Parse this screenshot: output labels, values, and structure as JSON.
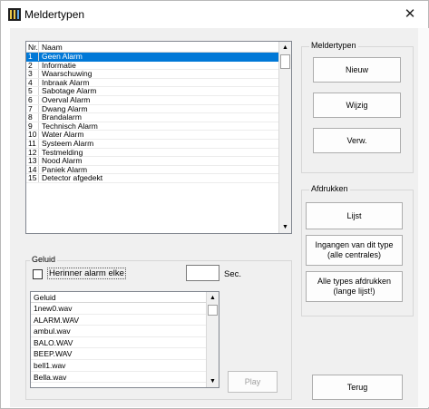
{
  "window": {
    "title": "Meldertypen",
    "close_glyph": "✕"
  },
  "types_list": {
    "headers": {
      "nr": "Nr.",
      "name": "Naam"
    },
    "rows": [
      {
        "nr": "1",
        "name": "Geen Alarm"
      },
      {
        "nr": "2",
        "name": "Informatie"
      },
      {
        "nr": "3",
        "name": "Waarschuwing"
      },
      {
        "nr": "4",
        "name": "Inbraak Alarm"
      },
      {
        "nr": "5",
        "name": "Sabotage Alarm"
      },
      {
        "nr": "6",
        "name": "Overval Alarm"
      },
      {
        "nr": "7",
        "name": "Dwang Alarm"
      },
      {
        "nr": "8",
        "name": "Brandalarm"
      },
      {
        "nr": "9",
        "name": "Technisch Alarm"
      },
      {
        "nr": "10",
        "name": "Water Alarm"
      },
      {
        "nr": "11",
        "name": "Systeem Alarm"
      },
      {
        "nr": "12",
        "name": "Testmelding"
      },
      {
        "nr": "13",
        "name": "Nood Alarm"
      },
      {
        "nr": "14",
        "name": "Paniek Alarm"
      },
      {
        "nr": "15",
        "name": "Detector afgedekt"
      }
    ],
    "selected_index": 0
  },
  "meldertypen_group": {
    "label": "Meldertypen",
    "new_button": "Nieuw",
    "edit_button": "Wijzig",
    "delete_button": "Verw."
  },
  "afdrukken_group": {
    "label": "Afdrukken",
    "list_button": "Lijst",
    "inputs_button": "Ingangen van dit type\n(alle centrales)",
    "all_types_button": "Alle types afdrukken\n(lange lijst!)"
  },
  "geluid_group": {
    "label": "Geluid",
    "repeat_checkbox_label": "Herinner alarm elke",
    "repeat_checked": false,
    "seconds_value": "",
    "seconds_label": "Sec.",
    "sound_list_header": "Geluid",
    "sounds": [
      "1new0.wav",
      "ALARM.WAV",
      "ambul.wav",
      "BALO.WAV",
      "BEEP.WAV",
      "bell1.wav",
      "Bella.wav"
    ],
    "play_button": "Play"
  },
  "back_button": "Terug",
  "icons": {
    "scroll_up": "▲",
    "scroll_down": "▼"
  }
}
